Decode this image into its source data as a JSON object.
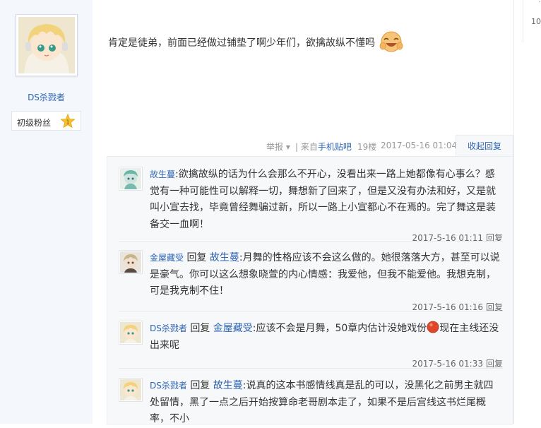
{
  "author": {
    "name": "DS杀戮者",
    "level_title": "初级粉丝",
    "level_number": "1"
  },
  "sidebar_right": {
    "number": "10"
  },
  "post": {
    "content": "肯定是徒弟，前面已经做过铺垫了啊少年们，欲擒故纵不懂吗"
  },
  "tail": {
    "report": "举报",
    "from_prefix": "| 来自",
    "from_link": "手机贴吧",
    "floor": "19楼",
    "time": "2017-05-16 01:04",
    "collapse": "收起回复"
  },
  "replies": [
    {
      "user": "故生蔓",
      "text": ":欲擒故纵的话为什么会那么不开心，没看出来一路上她都像有心事么？感觉有一种可能性可以解释一切，舞想新了回来了，但是又没有办法和好，又是就叫小宣去找，毕竟曾经舞骗过新，所以一路上小宣都心不在焉的。完了舞这是装备交一血啊！",
      "time": "2017-5-16 01:11",
      "reply_btn": "回复"
    },
    {
      "user": "金屋藏受",
      "prefix": "回复",
      "target": "故生蔓",
      "text": ":月舞的性格应该不会这么做的。她很落落大方，甚至可以说是豪气。你可以这么想象晓萱的内心情感：我爱他，但我不能爱他。我想克制，可是我克制不住！",
      "time": "2017-5-16 01:16",
      "reply_btn": "回复"
    },
    {
      "user": "DS杀戮者",
      "prefix": "回复",
      "target": "金屋藏受",
      "text_a": ":应该不会是月舞，50章内估计没她戏份",
      "text_b": "现在主线还没出来呢",
      "time": "2017-5-16 01:33",
      "reply_btn": "回复"
    },
    {
      "user": "DS杀戮者",
      "prefix": "回复",
      "target": "故生蔓",
      "text": ":说真的这本书感情线真是乱的可以，没黑化之前男主就四处留情，黑了一点之后开始按算命老哥剧本走了，如果不是后宫线这书烂尾概率，不小"
    }
  ]
}
